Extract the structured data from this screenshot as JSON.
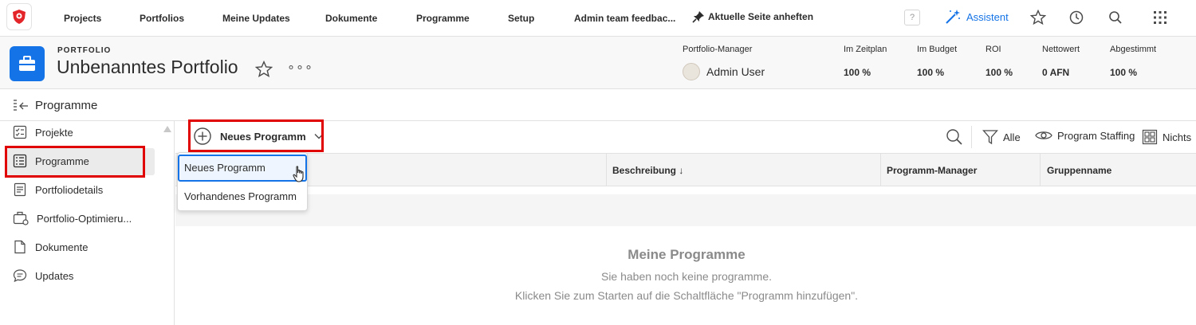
{
  "topnav": {
    "items": [
      "Projects",
      "Portfolios",
      "Meine Updates",
      "Dokumente",
      "Programme",
      "Setup",
      "Admin team feedbac..."
    ],
    "pin_label": "Aktuelle Seite anheften",
    "help_label": "?",
    "assistant_label": "Assistent"
  },
  "header": {
    "eyebrow": "PORTFOLIO",
    "title": "Unbenanntes Portfolio",
    "more": "∘∘∘",
    "manager_label": "Portfolio-Manager",
    "manager_name": "Admin User",
    "metrics": [
      {
        "label": "Im Zeitplan",
        "value": "100 %"
      },
      {
        "label": "Im Budget",
        "value": "100 %"
      },
      {
        "label": "ROI",
        "value": "100 %"
      },
      {
        "label": "Nettowert",
        "value": "0 AFN"
      },
      {
        "label": "Abgestimmt",
        "value": "100 %"
      }
    ]
  },
  "breadcrumb": {
    "title": "Programme"
  },
  "sidebar": {
    "items": [
      {
        "label": "Projekte",
        "icon": "checklist-icon"
      },
      {
        "label": "Programme",
        "icon": "list-icon"
      },
      {
        "label": "Portfoliodetails",
        "icon": "document-lines-icon"
      },
      {
        "label": "Portfolio-Optimieru...",
        "icon": "portfolio-settings-icon"
      },
      {
        "label": "Dokumente",
        "icon": "document-icon"
      },
      {
        "label": "Updates",
        "icon": "chat-icon"
      }
    ]
  },
  "toolbar": {
    "new_program_label": "Neues Programm",
    "filter_label": "Alle",
    "staffing_label": "Program Staffing",
    "view_label": "Nichts"
  },
  "table": {
    "columns": [
      "Beschreibung ↓",
      "Programm-Manager",
      "Gruppenname"
    ]
  },
  "dropdown": {
    "items": [
      "Neues Programm",
      "Vorhandenes Programm"
    ]
  },
  "empty": {
    "title": "Meine Programme",
    "line1": "Sie haben noch keine programme.",
    "line2": "Klicken Sie zum Starten auf die Schaltfläche \"Programm hinzufügen\"."
  },
  "colors": {
    "accent": "#1473e6",
    "highlight": "#e00000",
    "logo": "#e3252a"
  }
}
